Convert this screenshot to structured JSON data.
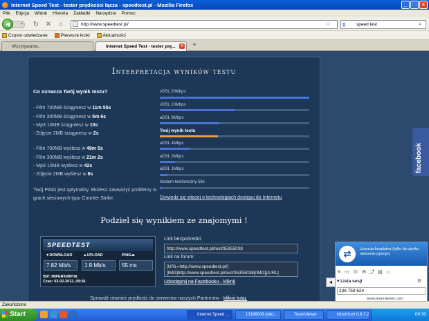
{
  "window": {
    "title": "Internet Speed Test - tester prędkości łącza - speedtest.pl - Mozilla Firefox"
  },
  "menu": [
    "Plik",
    "Edycja",
    "Widok",
    "Historia",
    "Zakładki",
    "Narzędzia",
    "Pomoc"
  ],
  "nav": {
    "url": "http://www.speedtest.pl/",
    "search": "speed test"
  },
  "bookmarks": [
    "Często odwiedzane",
    "Pierwsze kroki",
    "Aktualności"
  ],
  "tabs": [
    {
      "label": "Wczytywanie...",
      "active": false
    },
    {
      "label": "Internet Speed Test - tester prę...",
      "active": true
    }
  ],
  "page": {
    "heading": "Interpretacja wyników testu",
    "question": "Co oznacza Twój wynik testu?",
    "download_lines": [
      {
        "prefix": "- Film 700MB ściągniesz w ",
        "value": "11m 55s"
      },
      {
        "prefix": "- Film 300MB ściągniesz w ",
        "value": "5m 6s"
      },
      {
        "prefix": "- Mp3 10MB ściągniesz w ",
        "value": "10s"
      },
      {
        "prefix": "- Zdjęcie 2MB ściągniesz w ",
        "value": "2s"
      }
    ],
    "upload_lines": [
      {
        "prefix": "- Film 700MB wyślesz w ",
        "value": "49m 5s"
      },
      {
        "prefix": "- Film 300MB wyślesz w ",
        "value": "21m 2s"
      },
      {
        "prefix": "- Mp3 10MB wyślesz w ",
        "value": "42s"
      },
      {
        "prefix": "- Zdjęcie 2MB wyślesz w ",
        "value": "8s"
      }
    ],
    "ping_text": "Twój PING jest optymalny. Możesz zauważyć problemy w grach sieciowych typu Counter Strike.",
    "comparison": [
      {
        "label": "vDSL 20Mbps",
        "fraction": 1.0
      },
      {
        "label": "vDSL 10Mbps",
        "fraction": 0.5
      },
      {
        "label": "aDSL 8Mbps",
        "fraction": 0.4
      },
      {
        "label": "Twój wynik testu",
        "fraction": 0.39,
        "highlight": true
      },
      {
        "label": "aDSL 4Mbps",
        "fraction": 0.2
      },
      {
        "label": "aDSL 2Mbps",
        "fraction": 0.1
      },
      {
        "label": "aDSL 1Mbps",
        "fraction": 0.05
      },
      {
        "label": "Modem telefoniczny 56k",
        "fraction": 0.01
      }
    ],
    "more_info_link": "Dowiedz się więcej o technologiach dostępu do Internetu",
    "share_heading": "Podziel się wynikiem ze znajomymi !",
    "result_box": {
      "logo": "SPEEDTEST",
      "download_label": "DOWNLOAD",
      "upload_label": "UPLOAD",
      "ping_label": "PING",
      "download": "7.82 Mb/s",
      "upload": "1.9 Mb/s",
      "ping": "55 ms",
      "isp": "ISP: IMPERIUMP.W.",
      "date": "Czas: 03-02-2012, 09:36"
    },
    "direct_link_label": "Link bezpośredni:",
    "direct_link": "http://www.speedtest.pl/test/35355038",
    "forum_label": "Link na forum:",
    "forum_code": "[URL=http://www.speedtest.pl/][IMG]http://www.speedtest.pl/test/35355038[/IMG][/URL]",
    "facebook_share": "Udostępnij na Facebooku - kliknij",
    "footer_text": "Sprawdź również prędkość do serwerów naszych Partnerów - ",
    "footer_link": "kliknij tutaj."
  },
  "facebook_tab": "facebook",
  "teamviewer": {
    "license": "Licencja bezpłatna (tylko do użytku niekomercyjnego)",
    "session_label": "Lista sesji",
    "session_id": "236 759 624",
    "website": "www.teamviewer.com"
  },
  "statusbar": {
    "text": "Zakończono"
  },
  "taskbar": {
    "start": "Start",
    "items": [
      "Internet Speed ...",
      "13196008 (niez...",
      "TeamViewer",
      "MoorHunt 0.6.7.2"
    ],
    "clock": "09:30"
  }
}
